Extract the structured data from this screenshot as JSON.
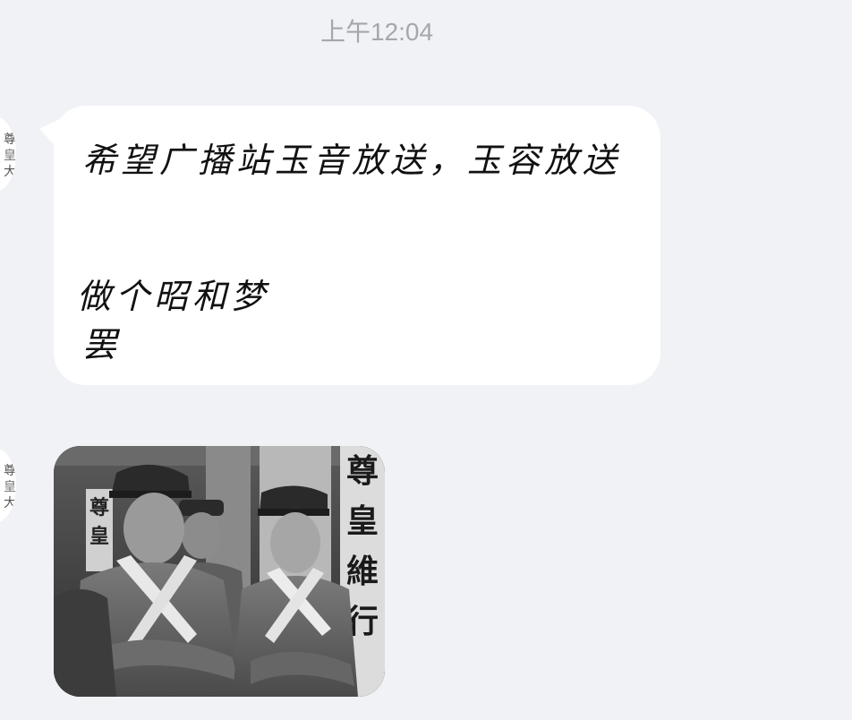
{
  "status": {
    "time": "上午12:04"
  },
  "contact": {
    "avatar_icon": "contact-avatar-icon"
  },
  "messages": [
    {
      "type": "text",
      "lines": [
        "希望广播站玉音放送，玉容放送",
        "做个昭和梦",
        "罢"
      ]
    },
    {
      "type": "image",
      "banner_text": [
        "尊",
        "皇",
        "維",
        "行"
      ],
      "small_banner_text": [
        "尊",
        "皇"
      ]
    }
  ],
  "colors": {
    "background": "#f1f2f6",
    "bubble": "#ffffff",
    "timestamp": "#a6a7ab",
    "text": "#111111"
  }
}
